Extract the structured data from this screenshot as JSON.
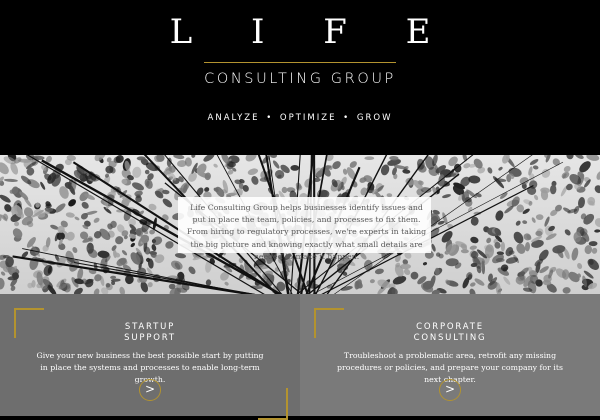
{
  "header": {
    "logo_main": "L I F E",
    "logo_sub": "CONSULTING GROUP",
    "tagline": "ANALYZE • OPTIMIZE • GROW"
  },
  "hero": {
    "intro": "Life Consulting Group helps businesses identify issues and put in place the team, policies, and processes to fix them. From hiring to regulatory processes, we're experts in taking the big picture and knowing exactly what small details are needed to make it happen."
  },
  "services": [
    {
      "title_line1": "STARTUP",
      "title_line2": "SUPPORT",
      "description": "Give your new business the best possible start by putting in place the systems and processes to enable long-term growth.",
      "button_icon": "chevron-right-icon",
      "button_label": ">"
    },
    {
      "title_line1": "CORPORATE",
      "title_line2": "CONSULTING",
      "description": "Troubleshoot a problematic area, retrofit any missing procedures or policies, and prepare your company for its next chapter.",
      "button_icon": "chevron-right-icon",
      "button_label": ">"
    }
  ],
  "colors": {
    "accent": "#b3932f",
    "header_bg": "#000000",
    "services_bg": "#6e6e6e"
  }
}
